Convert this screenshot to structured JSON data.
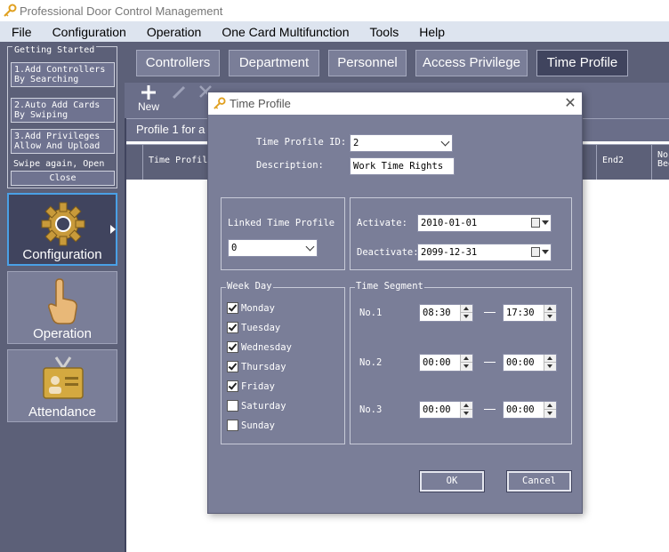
{
  "app": {
    "title": "Professional Door Control Management"
  },
  "menu": [
    "File",
    "Configuration",
    "Operation",
    "One Card Multifunction",
    "Tools",
    "Help"
  ],
  "getting_started": {
    "title": "Getting Started",
    "steps": [
      "1.Add Controllers\nBy Searching",
      "2.Auto Add Cards\nBy Swiping",
      "3.Add Privileges\nAllow And Upload"
    ],
    "note": "Swipe again, Open",
    "close": "Close"
  },
  "nav": [
    {
      "label": "Configuration",
      "icon": "gear-icon",
      "active": true
    },
    {
      "label": "Operation",
      "icon": "hand-pointer-icon",
      "active": false
    },
    {
      "label": "Attendance",
      "icon": "id-badge-icon",
      "active": false
    }
  ],
  "tabs": [
    "Controllers",
    "Department",
    "Personnel",
    "Access Privilege",
    "Time Profile"
  ],
  "toolbar": {
    "new_label": "New"
  },
  "info_text": "Profile 1 for a",
  "grid_columns": [
    "Time Profil",
    "End2",
    "No.\nBeg"
  ],
  "dialog": {
    "title": "Time Profile",
    "profile_id_label": "Time Profile ID:",
    "profile_id_value": "2",
    "description_label": "Description:",
    "description_value": "Work Time Rights",
    "linked_label": "Linked Time Profile",
    "linked_value": "0",
    "activate_label": "Activate:",
    "activate_value": "2010-01-01",
    "deactivate_label": "Deactivate:",
    "deactivate_value": "2099-12-31",
    "weekday_title": "Week Day",
    "weekdays": [
      {
        "label": "Monday",
        "checked": true
      },
      {
        "label": "Tuesday",
        "checked": true
      },
      {
        "label": "Wednesday",
        "checked": true
      },
      {
        "label": "Thursday",
        "checked": true
      },
      {
        "label": "Friday",
        "checked": true
      },
      {
        "label": "Saturday",
        "checked": false
      },
      {
        "label": "Sunday",
        "checked": false
      }
    ],
    "segment_title": "Time Segment",
    "segments": [
      {
        "label": "No.1",
        "start": "08:30",
        "end": "17:30"
      },
      {
        "label": "No.2",
        "start": "00:00",
        "end": "00:00"
      },
      {
        "label": "No.3",
        "start": "00:00",
        "end": "00:00"
      }
    ],
    "ok_label": "OK",
    "cancel_label": "Cancel"
  }
}
